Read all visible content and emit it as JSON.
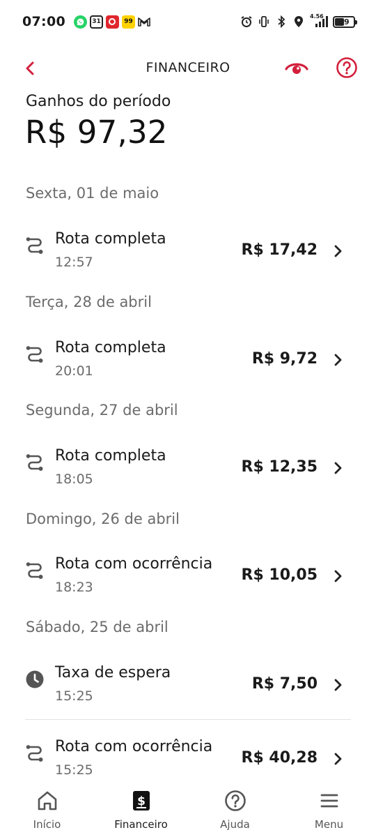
{
  "status_bar": {
    "time": "07:00",
    "apps": [
      "whatsapp-icon",
      "calendar-31-icon",
      "app-red-icon",
      "app-99-icon",
      "gmail-icon"
    ],
    "calendar_text": "31",
    "app99_text": "99",
    "network": "4.56",
    "battery": "39"
  },
  "header": {
    "title": "FINANCEIRO"
  },
  "summary": {
    "label": "Ganhos do período",
    "amount": "R$ 97,32"
  },
  "days": [
    {
      "label": "Sexta, 01 de maio",
      "entries": [
        {
          "icon": "route-icon",
          "title": "Rota completa",
          "time": "12:57",
          "amount": "R$ 17,42"
        }
      ]
    },
    {
      "label": "Terça, 28 de abril",
      "entries": [
        {
          "icon": "route-icon",
          "title": "Rota completa",
          "time": "20:01",
          "amount": "R$ 9,72"
        }
      ]
    },
    {
      "label": "Segunda, 27 de abril",
      "entries": [
        {
          "icon": "route-icon",
          "title": "Rota completa",
          "time": "18:05",
          "amount": "R$ 12,35"
        }
      ]
    },
    {
      "label": "Domingo, 26 de abril",
      "entries": [
        {
          "icon": "route-icon",
          "title": "Rota com ocorrência",
          "time": "18:23",
          "amount": "R$ 10,05"
        }
      ]
    },
    {
      "label": "Sábado, 25 de abril",
      "entries": [
        {
          "icon": "clock-icon",
          "title": "Taxa de espera",
          "time": "15:25",
          "amount": "R$ 7,50"
        },
        {
          "icon": "route-icon",
          "title": "Rota com ocorrência",
          "time": "15:25",
          "amount": "R$ 40,28"
        }
      ]
    }
  ],
  "bottom_nav": [
    {
      "icon": "home-icon",
      "label": "Início",
      "active": false
    },
    {
      "icon": "wallet-dollar-icon",
      "label": "Financeiro",
      "active": true
    },
    {
      "icon": "help-circle-icon",
      "label": "Ajuda",
      "active": false
    },
    {
      "icon": "menu-icon",
      "label": "Menu",
      "active": false
    }
  ],
  "colors": {
    "accent": "#d31f3c",
    "text": "#1a1a1a",
    "muted": "#6b6b6b"
  }
}
